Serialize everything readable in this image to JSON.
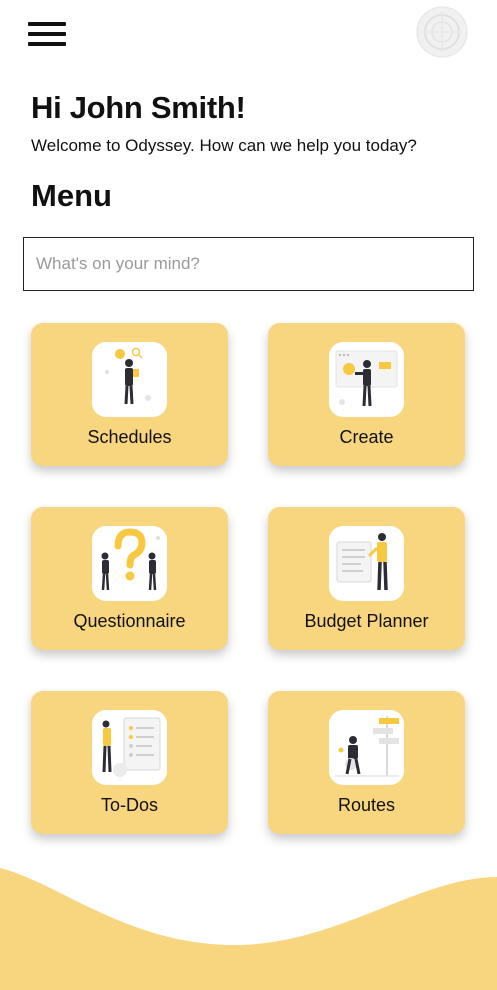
{
  "header": {
    "menu_icon": "hamburger-menu-icon",
    "avatar_icon": "profile-avatar-icon"
  },
  "greeting": {
    "title": "Hi John Smith!",
    "subtitle": "Welcome to Odyssey. How can we help you today?"
  },
  "menu": {
    "title": "Menu"
  },
  "search": {
    "placeholder": "What's on your mind?",
    "value": ""
  },
  "cards": [
    {
      "label": "Schedules",
      "icon": "schedules-illustration-icon"
    },
    {
      "label": "Create",
      "icon": "create-illustration-icon"
    },
    {
      "label": "Questionnaire",
      "icon": "questionnaire-illustration-icon"
    },
    {
      "label": "Budget Planner",
      "icon": "budget-planner-illustration-icon"
    },
    {
      "label": "To-Dos",
      "icon": "todos-illustration-icon"
    },
    {
      "label": "Routes",
      "icon": "routes-illustration-icon"
    }
  ],
  "colors": {
    "accent": "#f8d67f",
    "text": "#111111",
    "background": "#ffffff"
  }
}
